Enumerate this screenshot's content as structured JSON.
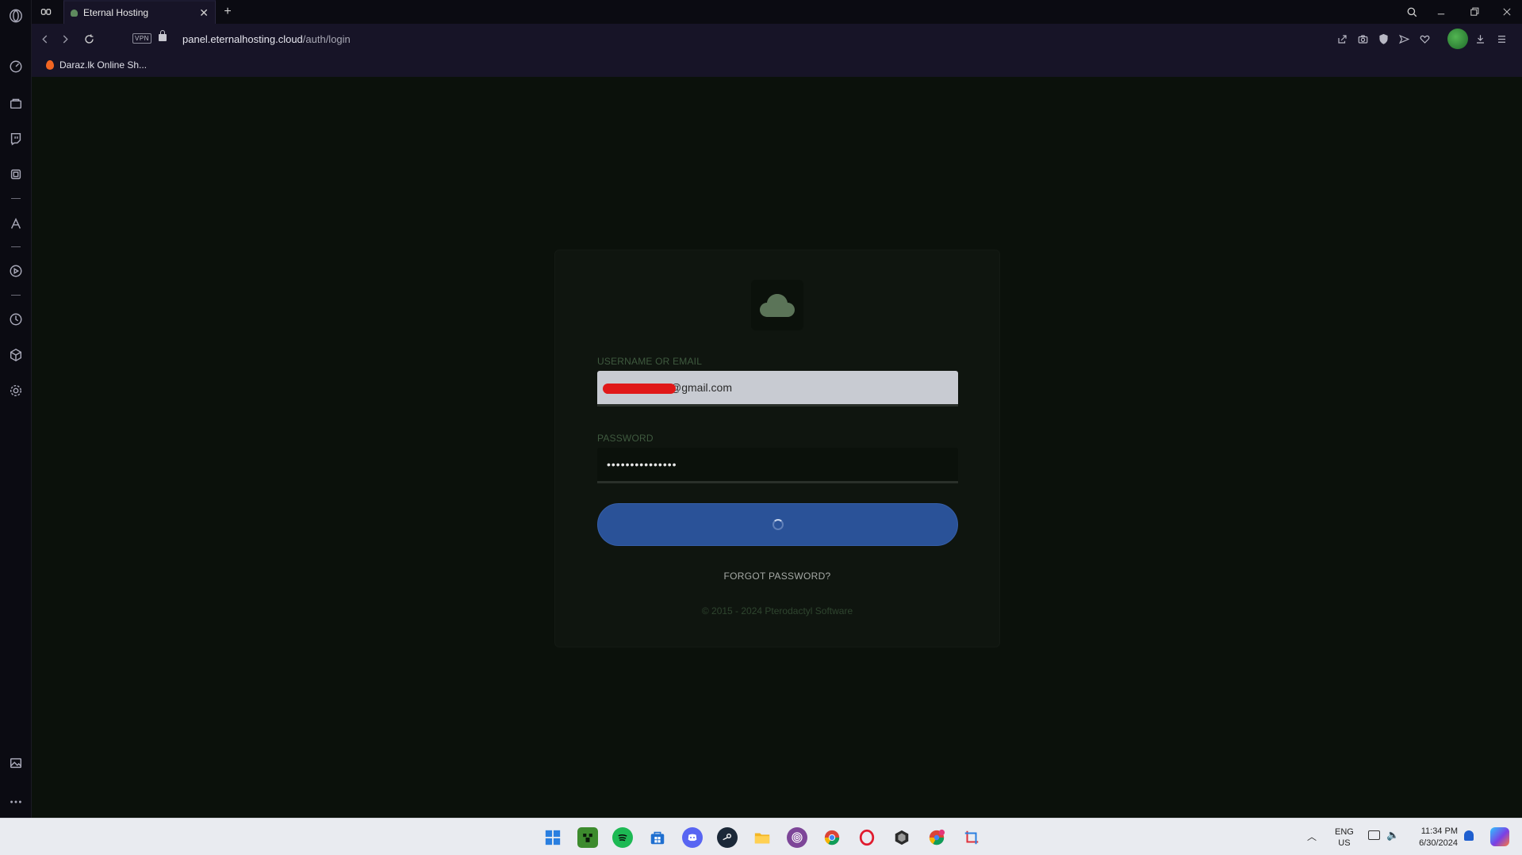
{
  "browser": {
    "tab": {
      "title": "Eternal Hosting",
      "close_icon": "close-icon"
    },
    "new_tab_label": "+",
    "address": {
      "vpn_badge": "VPN",
      "host": "panel.eternalhosting.cloud",
      "path": "/auth/login"
    },
    "bookmarks": [
      {
        "label": "Daraz.lk Online Sh..."
      }
    ]
  },
  "login": {
    "username_label": "USERNAME OR EMAIL",
    "username_value": "@gmail.com",
    "password_label": "PASSWORD",
    "password_value": "•••••••••••••••",
    "forgot_link": "FORGOT PASSWORD?",
    "copyright": "© 2015 - 2024 Pterodactyl Software"
  },
  "taskbar": {
    "apps": [
      "start-icon",
      "minecraft-icon",
      "spotify-icon",
      "store-icon",
      "discord-icon",
      "steam-icon",
      "file-explorer-icon",
      "tor-icon",
      "chrome-icon",
      "opera-icon",
      "unity-icon",
      "chrome-profile-icon",
      "snipping-tool-icon"
    ],
    "lang_line1": "ENG",
    "lang_line2": "US",
    "time": "11:34 PM",
    "date": "6/30/2024"
  },
  "colors": {
    "accent_button": "#2a5298",
    "page_bg": "#0b110b",
    "card_bg": "#0f150f"
  }
}
